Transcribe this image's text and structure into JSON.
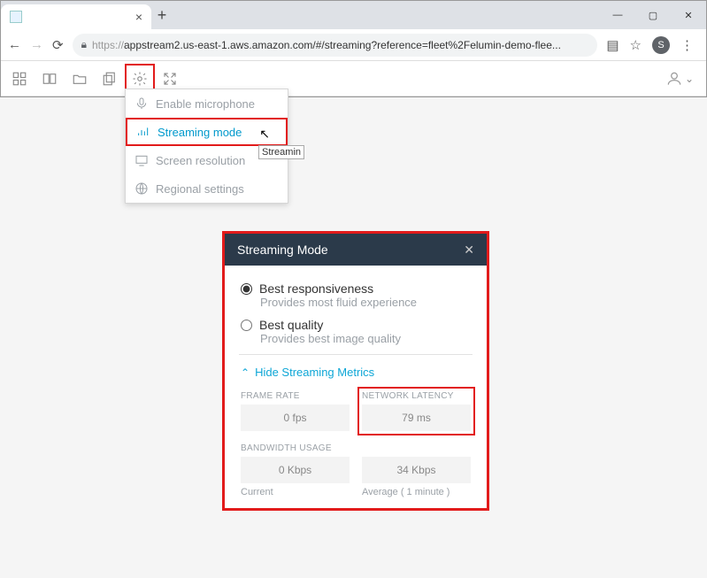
{
  "browser": {
    "tab_title": " ",
    "url_prefix": "https://",
    "url": "appstream2.us-east-1.aws.amazon.com/#/streaming?reference=fleet%2Felumin-demo-flee...",
    "avatar": "S"
  },
  "menu": {
    "enable_mic": "Enable microphone",
    "streaming_mode": "Streaming mode",
    "screen_res": "Screen resolution",
    "regional": "Regional settings"
  },
  "tooltip": "Streamin",
  "dialog": {
    "title": "Streaming Mode",
    "opt_responsiveness": "Best responsiveness",
    "opt_responsiveness_sub": "Provides most fluid experience",
    "opt_quality": "Best quality",
    "opt_quality_sub": "Provides best image quality",
    "hide_metrics": "Hide Streaming Metrics",
    "frame_rate_label": "FRAME RATE",
    "frame_rate_val": "0  fps",
    "latency_label": "NETWORK LATENCY",
    "latency_val": "79  ms",
    "bandwidth_label": "BANDWIDTH USAGE",
    "bandwidth_cur": "0  Kbps",
    "bandwidth_avg": "34  Kbps",
    "current": "Current",
    "average": "Average ( 1 minute )"
  }
}
